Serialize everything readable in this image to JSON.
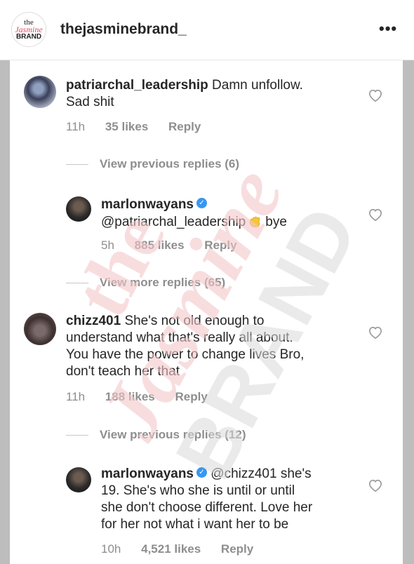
{
  "header": {
    "logo_line1": "the",
    "logo_line2": "Jasmine",
    "logo_line3": "BRAND",
    "username": "thejasminebrand_",
    "more_icon": "•••"
  },
  "comments": [
    {
      "user": "patriarchal_leadership",
      "text_line1": "Damn unfollow.",
      "text_line2": "Sad shit",
      "time": "11h",
      "likes": "35 likes",
      "reply": "Reply"
    },
    {
      "view_replies": "View previous replies (6)"
    },
    {
      "user": "marlonwayans",
      "verified": true,
      "mention": "@patriarchal_leadership",
      "emoji": "waving-hand-icon",
      "text": "bye",
      "time": "5h",
      "likes": "885 likes",
      "reply": "Reply"
    },
    {
      "view_replies": "View more replies (65)"
    },
    {
      "user": "chizz401",
      "text_line1": "She's not old enough to",
      "text_line2": "understand what that's really all about.",
      "text_line3": "You have the power to change lives Bro,",
      "text_line4": "don't teach her that",
      "time": "11h",
      "likes": "188 likes",
      "reply": "Reply"
    },
    {
      "view_replies": "View previous replies (12)"
    },
    {
      "user": "marlonwayans",
      "verified": true,
      "text_line1": "@chizz401 she's",
      "text_line2": "19. She's who she is until or until",
      "text_line3": "she don't choose different. Love her",
      "text_line4": "for her not what i want her to be",
      "time": "10h",
      "likes": "4,521 likes",
      "reply": "Reply"
    }
  ],
  "watermark": {
    "line1": "the",
    "line2": "Jasmine",
    "line3": "BRAND"
  },
  "colors": {
    "accent": "#3897f0",
    "watermark_red": "#f4c6ca",
    "watermark_gray": "#d9d9d9"
  }
}
